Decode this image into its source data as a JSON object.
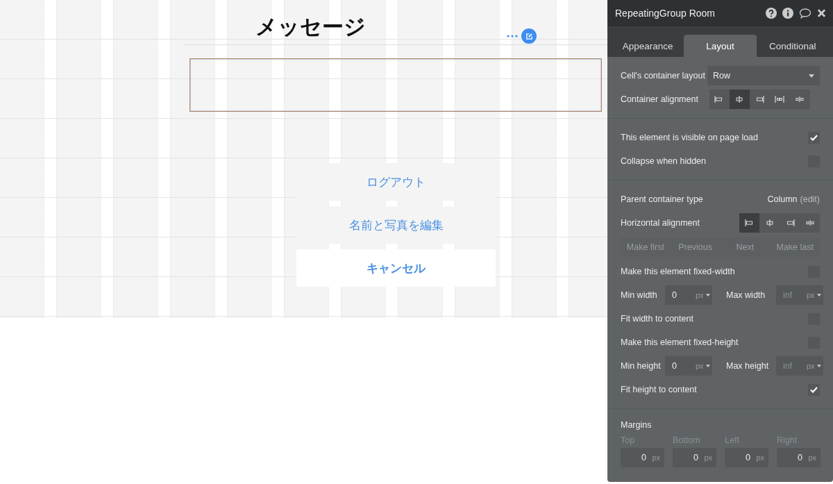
{
  "canvas": {
    "title": "メッセージ",
    "group_selected": true,
    "buttons": [
      {
        "label": "ログアウト",
        "kind": "secondary"
      },
      {
        "label": "名前と写真を編集",
        "kind": "secondary"
      },
      {
        "label": "キャンセル",
        "kind": "primary"
      }
    ]
  },
  "panel": {
    "title": "RepeatingGroup Room",
    "tabs": [
      {
        "label": "Appearance",
        "selected": false
      },
      {
        "label": "Layout",
        "selected": true
      },
      {
        "label": "Conditional",
        "selected": false
      }
    ],
    "sections": [
      {
        "rows": [
          {
            "kind": "dropdown",
            "label": "Cell's container layout",
            "value": "Row"
          },
          {
            "kind": "align",
            "label": "Container alignment",
            "options": [
              {
                "kind": "left",
                "selected": false
              },
              {
                "kind": "center",
                "selected": true
              },
              {
                "kind": "right",
                "selected": false
              },
              {
                "kind": "spread",
                "selected": false
              },
              {
                "kind": "around",
                "selected": false
              }
            ]
          }
        ]
      },
      {
        "rows": [
          {
            "kind": "checkbox",
            "label": "This element is visible on page load",
            "checked": true
          },
          {
            "kind": "checkbox",
            "label": "Collapse when hidden",
            "checked": false
          }
        ]
      },
      {
        "rows": [
          {
            "kind": "info",
            "label": "Parent container type",
            "value": "Column",
            "link": "(edit)"
          },
          {
            "kind": "align",
            "label": "Horizontal alignment",
            "options": [
              {
                "kind": "left",
                "selected": true
              },
              {
                "kind": "center",
                "selected": false
              },
              {
                "kind": "right",
                "selected": false
              },
              {
                "kind": "around",
                "selected": false
              }
            ]
          },
          {
            "kind": "buttons",
            "buttons": [
              {
                "label": "Make first",
                "disabled": true
              },
              {
                "label": "Previous",
                "disabled": true
              },
              {
                "label": "Next",
                "disabled": true
              },
              {
                "label": "Make last",
                "disabled": true
              }
            ]
          },
          {
            "kind": "checkbox",
            "label": "Make this element fixed-width",
            "checked": false
          },
          {
            "kind": "range",
            "fields": [
              {
                "label": "Min width",
                "value": "0",
                "unit": "px"
              },
              {
                "label": "Max width",
                "placeholder": "inf",
                "unit": "px"
              }
            ]
          },
          {
            "kind": "checkbox",
            "label": "Fit width to content",
            "checked": false
          },
          {
            "kind": "checkbox",
            "label": "Make this element fixed-height",
            "checked": false
          },
          {
            "kind": "range",
            "fields": [
              {
                "label": "Min height",
                "value": "0",
                "unit": "px"
              },
              {
                "label": "Max height",
                "placeholder": "inf",
                "unit": "px"
              }
            ]
          },
          {
            "kind": "checkbox",
            "label": "Fit height to content",
            "checked": true
          }
        ]
      },
      {
        "rows": [
          {
            "kind": "margins",
            "label": "Margins",
            "fields": [
              {
                "label": "Top",
                "value": "0",
                "unit": "px"
              },
              {
                "label": "Bottom",
                "value": "0",
                "unit": "px"
              },
              {
                "label": "Left",
                "value": "0",
                "unit": "px"
              },
              {
                "label": "Right",
                "value": "0",
                "unit": "px"
              }
            ]
          }
        ]
      }
    ]
  }
}
